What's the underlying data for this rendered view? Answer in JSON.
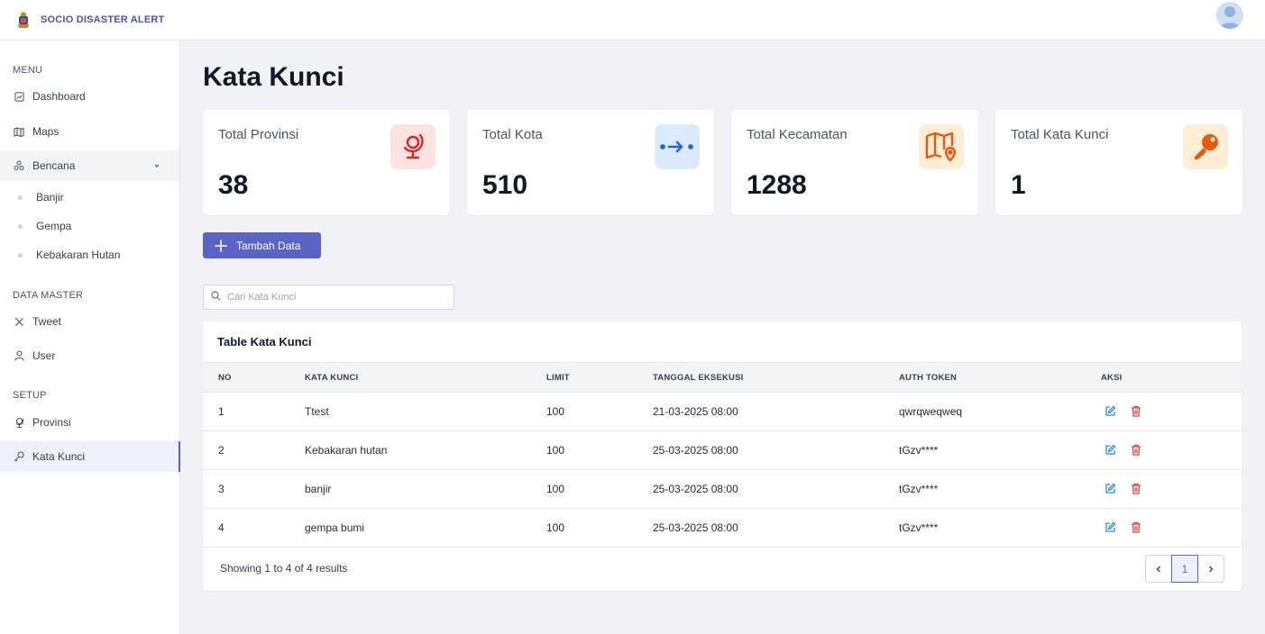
{
  "app": {
    "name": "SOCIO DISASTER ALERT"
  },
  "sidebar": {
    "sections": {
      "menu": "MENU",
      "data_master": "DATA MASTER",
      "setup": "SETUP"
    },
    "items": {
      "dashboard": "Dashboard",
      "maps": "Maps",
      "bencana": "Bencana",
      "banjir": "Banjir",
      "gempa": "Gempa",
      "kebakaran_hutan": "Kebakaran Hutan",
      "tweet": "Tweet",
      "user": "User",
      "provinsi": "Provinsi",
      "kata_kunci": "Kata Kunci"
    },
    "active": "kata_kunci"
  },
  "page": {
    "title": "Kata Kunci"
  },
  "stats": [
    {
      "label": "Total Provinsi",
      "value": "38",
      "icon": "globe-icon",
      "icon_color": "#dc2626",
      "icon_bg": "#fde2e2"
    },
    {
      "label": "Total Kota",
      "value": "510",
      "icon": "arrow-right-dots-icon",
      "icon_color": "#2563eb",
      "icon_bg": "#dbeafe"
    },
    {
      "label": "Total Kecamatan",
      "value": "1288",
      "icon": "map-pin-icon",
      "icon_color": "#ea580c",
      "icon_bg": "#ffedd5"
    },
    {
      "label": "Total Kata Kunci",
      "value": "1",
      "icon": "key-icon",
      "icon_color": "#ea580c",
      "icon_bg": "#ffedd5"
    }
  ],
  "actions": {
    "add_label": "Tambah Data"
  },
  "search": {
    "placeholder": "Cari Kata Kunci",
    "value": ""
  },
  "table": {
    "title": "Table Kata Kunci",
    "headers": {
      "no": "NO",
      "kata_kunci": "KATA KUNCI",
      "limit": "LIMIT",
      "tanggal": "TANGGAL EKSEKUSI",
      "token": "AUTH TOKEN",
      "aksi": "AKSI"
    },
    "rows": [
      {
        "no": "1",
        "kata_kunci": "Ttest",
        "limit": "100",
        "tanggal": "21-03-2025 08:00",
        "token": "qwrqweqweq"
      },
      {
        "no": "2",
        "kata_kunci": "Kebakaran hutan",
        "limit": "100",
        "tanggal": "25-03-2025 08:00",
        "token": "tGzv****"
      },
      {
        "no": "3",
        "kata_kunci": "banjir",
        "limit": "100",
        "tanggal": "25-03-2025 08:00",
        "token": "tGzv****"
      },
      {
        "no": "4",
        "kata_kunci": "gempa bumi",
        "limit": "100",
        "tanggal": "25-03-2025 08:00",
        "token": "tGzv****"
      }
    ],
    "footer": "Showing 1 to 4 of 4 results",
    "pagination": {
      "current_page": "1"
    }
  },
  "colors": {
    "accent": "#5b63c4",
    "edit": "#2b8fd6",
    "delete": "#e53e3e"
  }
}
